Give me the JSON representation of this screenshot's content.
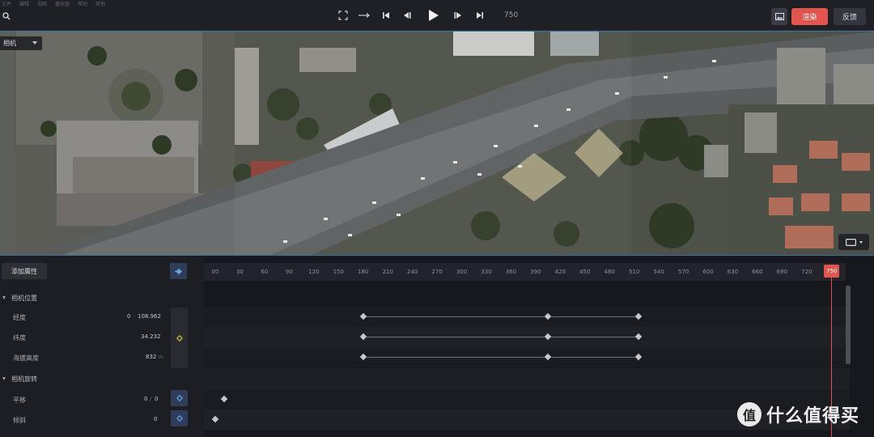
{
  "topbar": {
    "menu": [
      "文件",
      "编辑",
      "视图",
      "播放器",
      "帮助",
      "其他"
    ],
    "frame_count": "750",
    "render_label": "渲染",
    "feedback_label": "反馈"
  },
  "viewport": {
    "camera_label": "相机"
  },
  "props": {
    "add_label": "添加属性",
    "groups": [
      {
        "title": "相机位置",
        "rows": [
          {
            "label": "经度",
            "value_a": "0",
            "value_b": "108.962"
          },
          {
            "label": "纬度",
            "value_a": "34.232",
            "unit": ""
          },
          {
            "label": "海拔高度",
            "value_a": "832",
            "unit": "m"
          }
        ]
      },
      {
        "title": "相机旋转",
        "rows": [
          {
            "label": "平移",
            "value_a": "0",
            "value_b": "0"
          },
          {
            "label": "倾斜",
            "value_a": "0"
          }
        ]
      }
    ]
  },
  "timeline": {
    "ticks": [
      "00",
      "30",
      "60",
      "90",
      "120",
      "150",
      "180",
      "210",
      "240",
      "270",
      "300",
      "330",
      "360",
      "390",
      "420",
      "450",
      "480",
      "510",
      "540",
      "570",
      "600",
      "630",
      "660",
      "690",
      "720"
    ],
    "playhead_label": "750",
    "keyframes": {
      "longitude": [
        180,
        405,
        515
      ],
      "latitude": [
        180,
        405,
        515
      ],
      "altitude": [
        180,
        405,
        515
      ],
      "pan": [
        11
      ],
      "tilt": [
        0
      ]
    },
    "max_frame": 750
  },
  "watermark": {
    "badge": "值",
    "text": "什么值得买"
  },
  "colors": {
    "accent": "#e0564e",
    "selection": "#3b6fa0"
  }
}
